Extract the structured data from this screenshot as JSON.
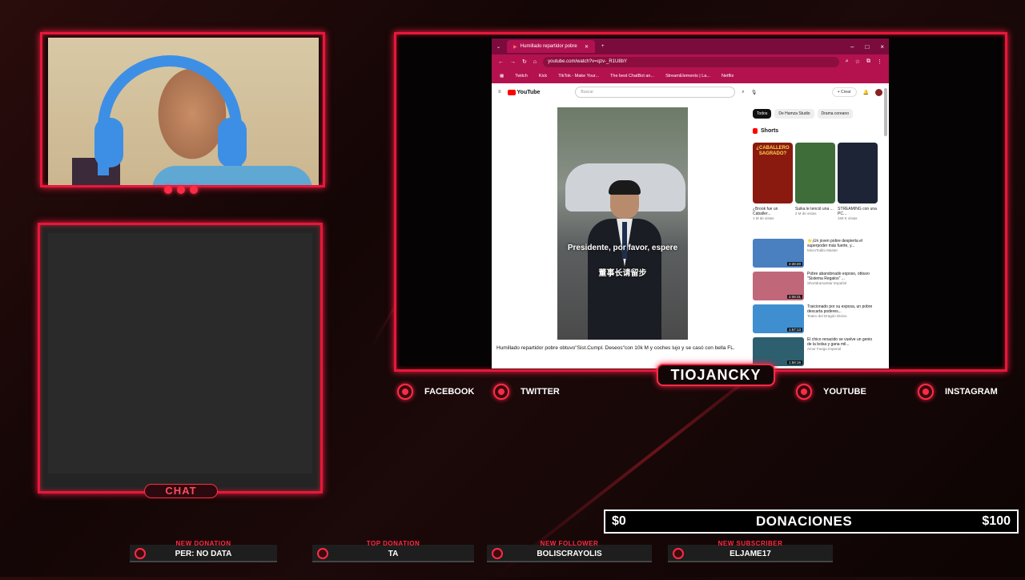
{
  "browser": {
    "tab_title": "Humillado repartidor pobre",
    "url": "youtube.com/watch?v=qzv-_R1U8bY",
    "bookmarks": [
      "Twitch",
      "Kick",
      "TikTok - Make Your...",
      "The best ChatBot an...",
      "StreamElements | La...",
      "Netflix"
    ],
    "window_controls": [
      "–",
      "□",
      "×"
    ]
  },
  "youtube": {
    "logo_text": "YouTube",
    "search_placeholder": "Buscar",
    "create_label": "+ Crear",
    "chips": [
      "Todos",
      "De Hamza Studio",
      "Drama coreano"
    ],
    "shorts_label": "Shorts",
    "shorts": [
      {
        "caption": "¿CABALLERO SAGRADO?",
        "title": "¿Brook fue un Caballer...",
        "views": "1 M de vistas",
        "color": "#8a1a10"
      },
      {
        "caption": "",
        "title": "Suika le tenció una ...",
        "views": "2 M de vistas",
        "color": "#3f6d3a"
      },
      {
        "caption": "",
        "title": "STREAMING con una PC...",
        "views": "159 K vistas",
        "color": "#1d2436"
      }
    ],
    "recommendations": [
      {
        "title": "⭐¡Un joven pobre despierta el superpoder más fuerte, y...",
        "meta": "MicroTodito Master",
        "duration": "2:28:20",
        "color": "#4a80c0"
      },
      {
        "title": "Pobre abandonado esposo, obtuvo \"Sistema Regalos\" ...",
        "meta": "ShortdramaStar Español",
        "duration": "2:08:31",
        "color": "#c0687a"
      },
      {
        "title": "Traicionado por su esposa, un pobre descarta poderes...",
        "meta": "Teatro del Dragón Divino",
        "duration": "1:57:13",
        "color": "#3f8fd0"
      },
      {
        "title": "El chico renacido se vuelve un genio de la bolsa y gana mil...",
        "meta": "Amor Fuego Imperial",
        "duration": "1:58:16",
        "color": "#2d5f6f"
      }
    ],
    "video": {
      "subtitle_es": "Presidente, por favor, espere",
      "subtitle_zh": "董事长请留步",
      "title": "Humillado repartidor pobre obtuvo\"Sist.Cumpl. Deseos\"con 10k M y coches lujo y se casó con bella FL.",
      "channel": "Hamza Studio"
    }
  },
  "overlay": {
    "streamer_name": "TIOJANCKY",
    "chat_label": "CHAT",
    "socials": [
      {
        "label": "FACEBOOK"
      },
      {
        "label": "TWITTER"
      },
      {
        "label": "YOUTUBE"
      },
      {
        "label": "INSTAGRAM"
      }
    ],
    "donations": {
      "min": "$0",
      "label": "DONACIONES",
      "max": "$100"
    },
    "alerts": [
      {
        "label": "NEW DONATION",
        "value": "PER: NO DATA"
      },
      {
        "label": "TOP DONATION",
        "value": "TA"
      },
      {
        "label": "NEW FOLLOWER",
        "value": "BOLISCRAYOLIS"
      },
      {
        "label": "NEW SUBSCRIBER",
        "value": "ELJAME17"
      }
    ]
  },
  "colors": {
    "accent": "#ff2b45",
    "browser_chrome": "#b3124f"
  }
}
